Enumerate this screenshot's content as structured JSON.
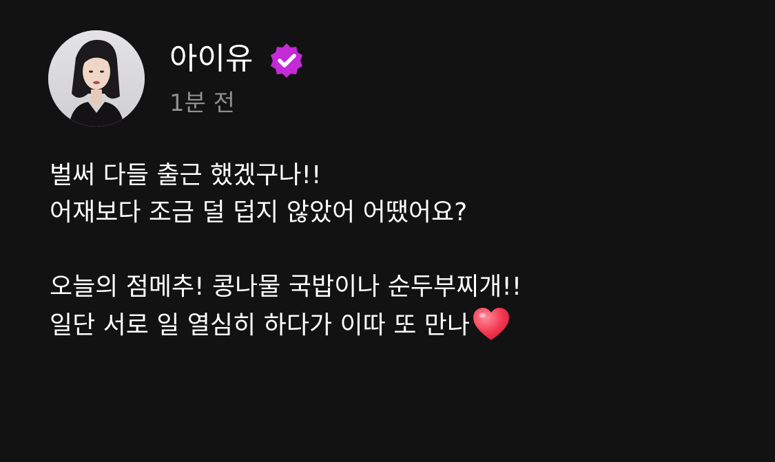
{
  "post": {
    "author": {
      "name": "아이유",
      "verified": true,
      "verified_icon": "verified-badge-icon",
      "verified_color": "#c42ad6"
    },
    "timestamp": "1분 전",
    "body": {
      "lines": [
        "벌써 다들 출근 했겠구나!!",
        "어재보다 조금 덜 덥지 않았어 어땠어요?",
        "오늘의 점메추!  콩나물 국밥이나 순두부찌개!!",
        "일단 서로 일 열심히 하다가 이따 또 만나"
      ],
      "trailing_emoji": "heart-emoji"
    }
  },
  "theme": {
    "background": "#121212",
    "text": "#ffffff",
    "muted": "#8e8e8e"
  }
}
